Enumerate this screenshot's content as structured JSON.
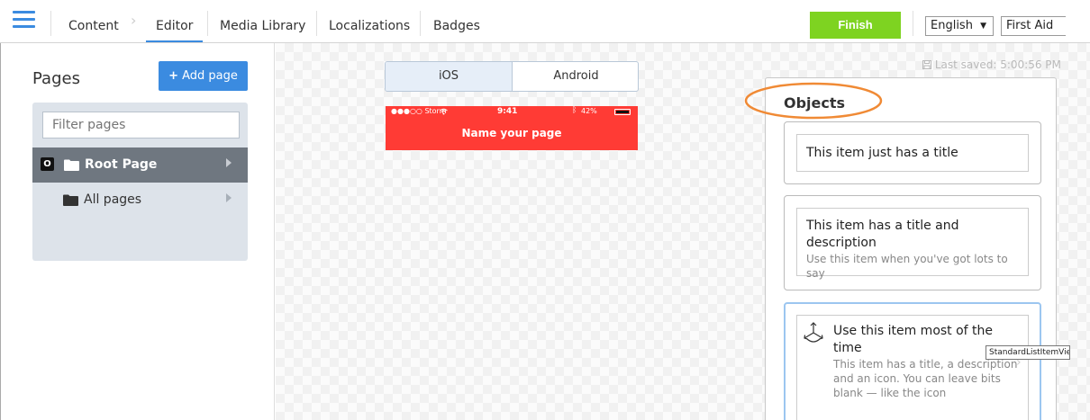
{
  "nav": {
    "items": [
      {
        "label": "Content"
      },
      {
        "label": "Editor"
      },
      {
        "label": "Media Library"
      },
      {
        "label": "Localizations"
      },
      {
        "label": "Badges"
      }
    ],
    "finish_label": "Finish",
    "language_select": "English",
    "app_select": "First Aid"
  },
  "sidebar": {
    "title": "Pages",
    "add_page_label": "Add page",
    "filter_placeholder": "Filter pages",
    "root_badge": "O",
    "root_label": "Root Page",
    "all_pages_label": "All pages"
  },
  "preview": {
    "platforms": [
      "iOS",
      "Android"
    ],
    "selected_platform": "iOS",
    "status_left": "●●●○○ Storm",
    "status_time": "9:41",
    "status_battery": "42%",
    "page_title": "Name your page",
    "header_color": "#ff3b35"
  },
  "last_saved": "Last saved: 5:00:56 PM",
  "objects": {
    "title": "Objects",
    "items": [
      {
        "title": "This item just has a title",
        "description": ""
      },
      {
        "title": "This item has a title and description",
        "description": "Use this item when you've got lots to say"
      },
      {
        "title": "Use this item most of the time",
        "description": "This item has a title, a description and an icon. You can leave bits blank — like the icon"
      }
    ],
    "tooltip": "StandardListItemView"
  },
  "colors": {
    "accent": "#3b8be0",
    "finish": "#7ed321",
    "annotation": "#f08a35"
  }
}
